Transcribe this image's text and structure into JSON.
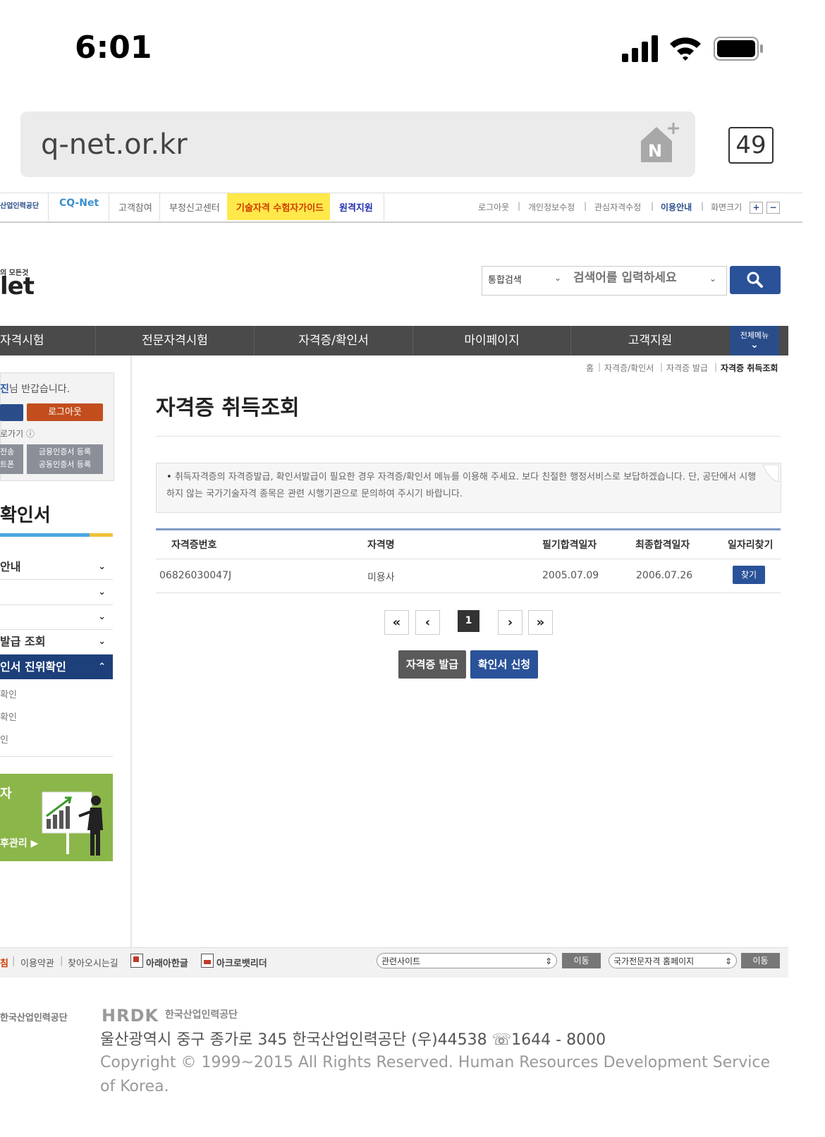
{
  "status": {
    "time": "6:01"
  },
  "browser": {
    "url": "q-net.or.kr",
    "tab_count": "49"
  },
  "util": {
    "logo_text": "산업인력공단",
    "cq_net": "CQ-Net",
    "links": [
      "고객참여",
      "부정신고센터"
    ],
    "guide": "기술자격 수험자가이드",
    "remote": "원격지원",
    "right": [
      "로그아웃",
      "개인정보수정",
      "관심자격수정",
      "이용안내",
      "화면크기"
    ],
    "plus": "+",
    "minus": "−"
  },
  "header": {
    "brand_small": "의 모든것",
    "brand_big": "let",
    "search_category": "통합검색",
    "search_placeholder": "검색어를 입력하세요"
  },
  "gnb": {
    "items": [
      "자격시험",
      "전문자격시험",
      "자격증/확인서",
      "마이페이지",
      "고객지원"
    ],
    "all_menu": "전체메뉴"
  },
  "sidebar": {
    "greeting": "진님 반갑습니다.",
    "logout": "로그아웃",
    "go_back": "로가기",
    "cert_left": [
      "전송",
      "트폰"
    ],
    "cert_right": [
      "금융인증서 등록",
      "공동인증서 등록"
    ],
    "title": "확인서",
    "menu": [
      "안내",
      "",
      "",
      "발급 조회"
    ],
    "active": "인서 진위확인",
    "sub": [
      "확인",
      "확인",
      "인"
    ],
    "banner_top": "자",
    "banner_bottom": "후관리"
  },
  "breadcrumb": [
    "홈",
    "자격증/확인서",
    "자격증 발급",
    "자격증 취득조회"
  ],
  "page_title": "자격증 취득조회",
  "notice": "취득자격증의 자격증발급, 확인서발급이 필요한 경우 자격증/확인서 메뉴를 이용해 주세요. 보다 친절한 행정서비스로 보답하겠습니다. 단, 공단에서 시행하지 않는 국가기술자격 종목은 관련 시행기관으로 문의하여 주시기 바랍니다.",
  "table": {
    "headers": [
      "자격증번호",
      "자격명",
      "필기합격일자",
      "최종합격일자",
      "일자리찾기"
    ],
    "rows": [
      {
        "number": "06826030047J",
        "name": "미용사",
        "written": "2005.07.09",
        "final": "2006.07.26",
        "find": "찾기"
      }
    ]
  },
  "pagination": {
    "first": "«",
    "prev": "‹",
    "current": "1",
    "next": "›",
    "last": "»"
  },
  "actions": {
    "issue": "자격증 발급",
    "apply": "확인서 신청"
  },
  "footer": {
    "policy": "침",
    "links": [
      "이용약관",
      "찾아오시는길"
    ],
    "hangul": "아래아한글",
    "acrobat": "아크로뱃리더",
    "related": "관련사이트",
    "national": "국가전문자격 홈페이지",
    "go": "이동",
    "org_logo": "한국산업인력공단",
    "hrdk": "HRDK",
    "hrdk_kr": "한국산업인력공단",
    "address": "울산광역시 중구 종가로 345 한국산업인력공단 (우)44538 ☏1644 - 8000",
    "copyright": "Copyright © 1999~2015 All Rights Reserved. Human Resources Development Service of Korea."
  }
}
